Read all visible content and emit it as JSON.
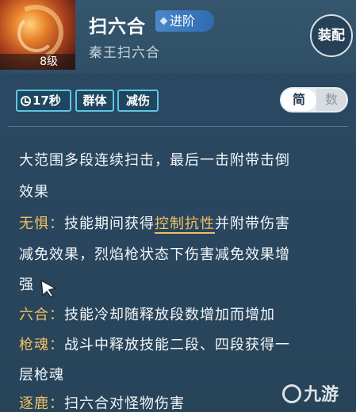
{
  "skill": {
    "level": "8级",
    "name": "扫六合",
    "advance_label": "进阶",
    "subtitle": "秦王扫六合",
    "equip_label": "装配"
  },
  "tags": {
    "cooldown": "17秒",
    "group": "群体",
    "reduce": "减伤"
  },
  "toggle": {
    "simple": "简",
    "number": "数"
  },
  "description": {
    "line1": "大范围多段连续扫击，最后一击附带击倒",
    "line2": "效果",
    "fearless_key": "无惧：",
    "fearless_a": "技能期间获得",
    "fearless_hl": "控制抗性",
    "fearless_b": "并附带伤害",
    "fearless_line2": "减免效果，烈焰枪状态下伤害减免效果增",
    "fearless_line3": "强",
    "liuhe_key": "六合：",
    "liuhe_text": "技能冷却随释放段数增加而增加",
    "soul_key": "枪魂：",
    "soul_text": "战斗中释放技能二段、四段获得一",
    "soul_line2": "层枪魂",
    "deer_key": "逐鹿：",
    "deer_text": "扫六合对怪物伤害"
  },
  "watermark": "九游"
}
